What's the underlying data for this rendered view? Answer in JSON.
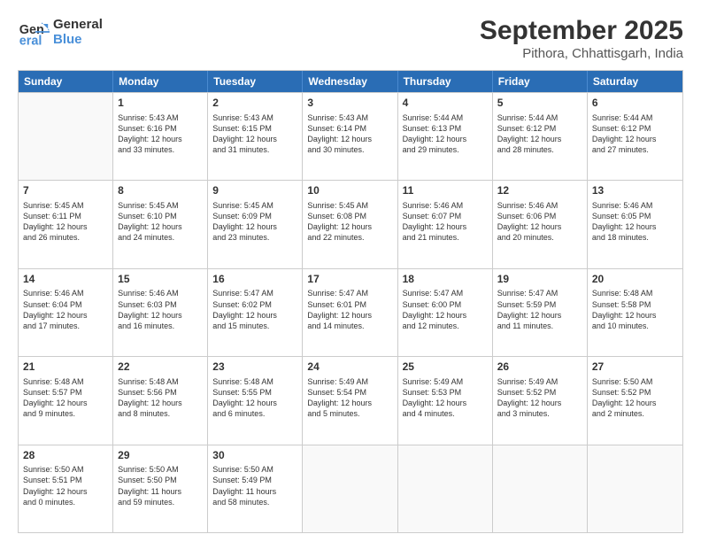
{
  "logo": {
    "line1": "General",
    "line2": "Blue"
  },
  "title": "September 2025",
  "location": "Pithora, Chhattisgarh, India",
  "weekdays": [
    "Sunday",
    "Monday",
    "Tuesday",
    "Wednesday",
    "Thursday",
    "Friday",
    "Saturday"
  ],
  "weeks": [
    [
      {
        "day": "",
        "info": ""
      },
      {
        "day": "1",
        "info": "Sunrise: 5:43 AM\nSunset: 6:16 PM\nDaylight: 12 hours\nand 33 minutes."
      },
      {
        "day": "2",
        "info": "Sunrise: 5:43 AM\nSunset: 6:15 PM\nDaylight: 12 hours\nand 31 minutes."
      },
      {
        "day": "3",
        "info": "Sunrise: 5:43 AM\nSunset: 6:14 PM\nDaylight: 12 hours\nand 30 minutes."
      },
      {
        "day": "4",
        "info": "Sunrise: 5:44 AM\nSunset: 6:13 PM\nDaylight: 12 hours\nand 29 minutes."
      },
      {
        "day": "5",
        "info": "Sunrise: 5:44 AM\nSunset: 6:12 PM\nDaylight: 12 hours\nand 28 minutes."
      },
      {
        "day": "6",
        "info": "Sunrise: 5:44 AM\nSunset: 6:12 PM\nDaylight: 12 hours\nand 27 minutes."
      }
    ],
    [
      {
        "day": "7",
        "info": "Sunrise: 5:45 AM\nSunset: 6:11 PM\nDaylight: 12 hours\nand 26 minutes."
      },
      {
        "day": "8",
        "info": "Sunrise: 5:45 AM\nSunset: 6:10 PM\nDaylight: 12 hours\nand 24 minutes."
      },
      {
        "day": "9",
        "info": "Sunrise: 5:45 AM\nSunset: 6:09 PM\nDaylight: 12 hours\nand 23 minutes."
      },
      {
        "day": "10",
        "info": "Sunrise: 5:45 AM\nSunset: 6:08 PM\nDaylight: 12 hours\nand 22 minutes."
      },
      {
        "day": "11",
        "info": "Sunrise: 5:46 AM\nSunset: 6:07 PM\nDaylight: 12 hours\nand 21 minutes."
      },
      {
        "day": "12",
        "info": "Sunrise: 5:46 AM\nSunset: 6:06 PM\nDaylight: 12 hours\nand 20 minutes."
      },
      {
        "day": "13",
        "info": "Sunrise: 5:46 AM\nSunset: 6:05 PM\nDaylight: 12 hours\nand 18 minutes."
      }
    ],
    [
      {
        "day": "14",
        "info": "Sunrise: 5:46 AM\nSunset: 6:04 PM\nDaylight: 12 hours\nand 17 minutes."
      },
      {
        "day": "15",
        "info": "Sunrise: 5:46 AM\nSunset: 6:03 PM\nDaylight: 12 hours\nand 16 minutes."
      },
      {
        "day": "16",
        "info": "Sunrise: 5:47 AM\nSunset: 6:02 PM\nDaylight: 12 hours\nand 15 minutes."
      },
      {
        "day": "17",
        "info": "Sunrise: 5:47 AM\nSunset: 6:01 PM\nDaylight: 12 hours\nand 14 minutes."
      },
      {
        "day": "18",
        "info": "Sunrise: 5:47 AM\nSunset: 6:00 PM\nDaylight: 12 hours\nand 12 minutes."
      },
      {
        "day": "19",
        "info": "Sunrise: 5:47 AM\nSunset: 5:59 PM\nDaylight: 12 hours\nand 11 minutes."
      },
      {
        "day": "20",
        "info": "Sunrise: 5:48 AM\nSunset: 5:58 PM\nDaylight: 12 hours\nand 10 minutes."
      }
    ],
    [
      {
        "day": "21",
        "info": "Sunrise: 5:48 AM\nSunset: 5:57 PM\nDaylight: 12 hours\nand 9 minutes."
      },
      {
        "day": "22",
        "info": "Sunrise: 5:48 AM\nSunset: 5:56 PM\nDaylight: 12 hours\nand 8 minutes."
      },
      {
        "day": "23",
        "info": "Sunrise: 5:48 AM\nSunset: 5:55 PM\nDaylight: 12 hours\nand 6 minutes."
      },
      {
        "day": "24",
        "info": "Sunrise: 5:49 AM\nSunset: 5:54 PM\nDaylight: 12 hours\nand 5 minutes."
      },
      {
        "day": "25",
        "info": "Sunrise: 5:49 AM\nSunset: 5:53 PM\nDaylight: 12 hours\nand 4 minutes."
      },
      {
        "day": "26",
        "info": "Sunrise: 5:49 AM\nSunset: 5:52 PM\nDaylight: 12 hours\nand 3 minutes."
      },
      {
        "day": "27",
        "info": "Sunrise: 5:50 AM\nSunset: 5:52 PM\nDaylight: 12 hours\nand 2 minutes."
      }
    ],
    [
      {
        "day": "28",
        "info": "Sunrise: 5:50 AM\nSunset: 5:51 PM\nDaylight: 12 hours\nand 0 minutes."
      },
      {
        "day": "29",
        "info": "Sunrise: 5:50 AM\nSunset: 5:50 PM\nDaylight: 11 hours\nand 59 minutes."
      },
      {
        "day": "30",
        "info": "Sunrise: 5:50 AM\nSunset: 5:49 PM\nDaylight: 11 hours\nand 58 minutes."
      },
      {
        "day": "",
        "info": ""
      },
      {
        "day": "",
        "info": ""
      },
      {
        "day": "",
        "info": ""
      },
      {
        "day": "",
        "info": ""
      }
    ]
  ]
}
